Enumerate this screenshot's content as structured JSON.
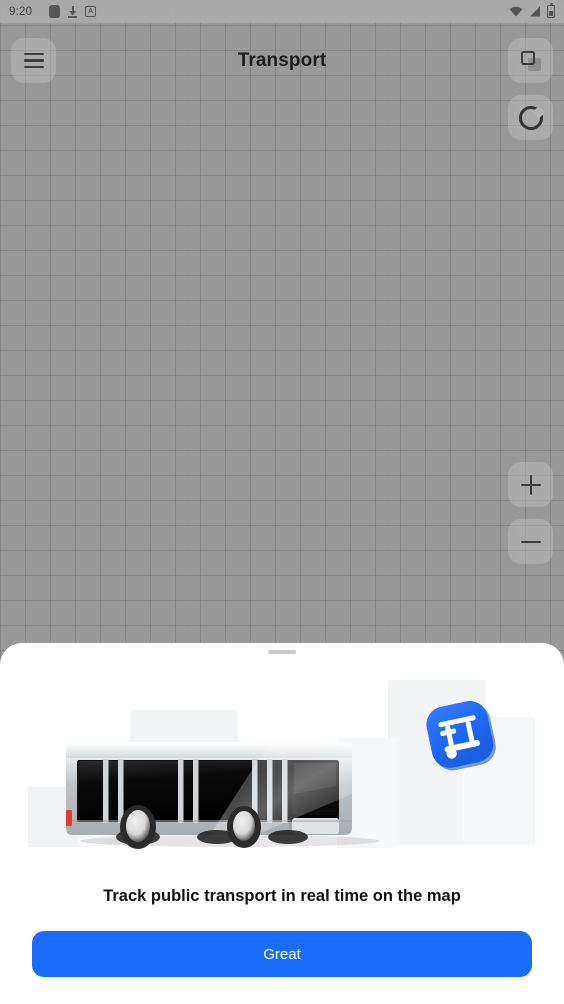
{
  "status_bar": {
    "time": "9:20",
    "left_icons": [
      "app-box-icon",
      "download-icon",
      "a-box-icon"
    ],
    "a_glyph": "A",
    "right_icons": [
      "wifi-icon",
      "signal-icon",
      "battery-icon"
    ]
  },
  "top_bar": {
    "menu_icon": "hamburger-menu-icon",
    "title": "Transport"
  },
  "map_controls": {
    "layers_icon": "layers-icon",
    "locate_icon": "locate-compass-icon",
    "zoom_in_icon": "plus-icon",
    "zoom_out_icon": "minus-icon"
  },
  "map": {
    "state": "grid-placeholder",
    "background_color": "#999999"
  },
  "bottom_sheet": {
    "drag_handle": "drag-handle",
    "illustration": {
      "bus_icon": "city-bus-illustration",
      "badge_icon": "tram-app-badge-icon",
      "badge_color": "#1a6dfb",
      "buildings": "city-buildings-silhouette"
    },
    "caption": "Track public transport in real time on the map",
    "cta": {
      "label": "Great",
      "color": "#1a6dfb",
      "text_color": "#ffffff"
    }
  }
}
